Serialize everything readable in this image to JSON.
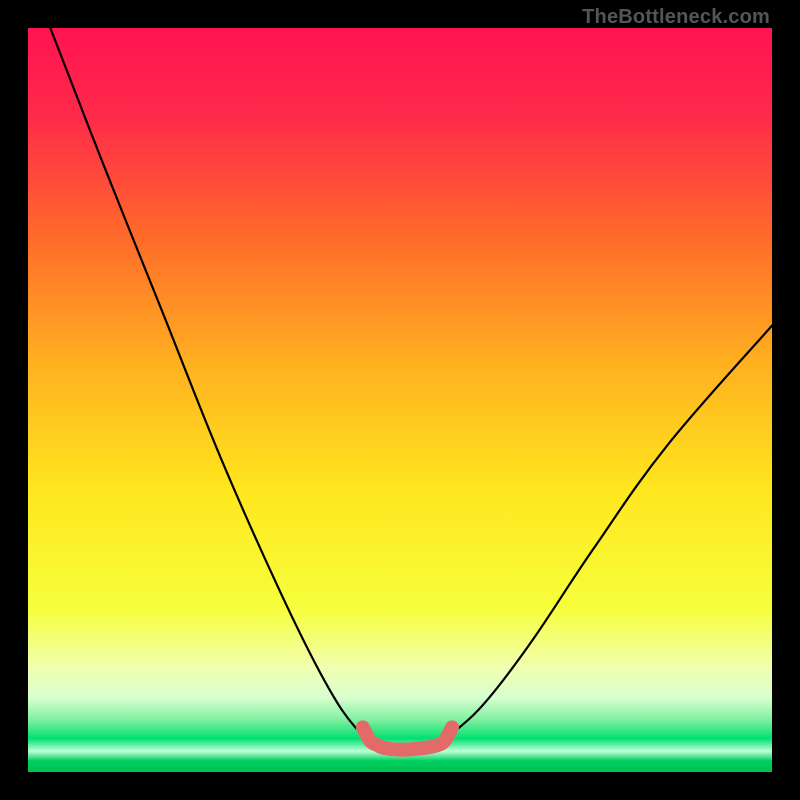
{
  "watermark": "TheBottleneck.com",
  "colors": {
    "frame": "#000000",
    "curve": "#000000",
    "accent": "#e46a6a",
    "gradient_stops": [
      {
        "offset": 0.0,
        "color": "#ff1450"
      },
      {
        "offset": 0.12,
        "color": "#ff2a4a"
      },
      {
        "offset": 0.28,
        "color": "#ff6a2a"
      },
      {
        "offset": 0.45,
        "color": "#ffb020"
      },
      {
        "offset": 0.62,
        "color": "#ffe61e"
      },
      {
        "offset": 0.78,
        "color": "#f6ff3c"
      },
      {
        "offset": 0.86,
        "color": "#f0ffb0"
      },
      {
        "offset": 0.9,
        "color": "#d8ffd0"
      },
      {
        "offset": 0.93,
        "color": "#80f0a0"
      },
      {
        "offset": 0.955,
        "color": "#00e070"
      },
      {
        "offset": 0.972,
        "color": "#c0ffd8"
      },
      {
        "offset": 0.985,
        "color": "#00d060"
      },
      {
        "offset": 1.0,
        "color": "#00c050"
      }
    ]
  },
  "chart_data": {
    "type": "line",
    "title": "",
    "xlabel": "",
    "ylabel": "",
    "xlim": [
      0,
      100
    ],
    "ylim": [
      0,
      100
    ],
    "series": [
      {
        "name": "left-curve",
        "x": [
          3,
          10,
          18,
          26,
          34,
          40,
          44,
          47
        ],
        "y": [
          100,
          82,
          62,
          42,
          24,
          12,
          6,
          4
        ]
      },
      {
        "name": "right-curve",
        "x": [
          55,
          58,
          62,
          68,
          76,
          86,
          100
        ],
        "y": [
          4,
          6,
          10,
          18,
          30,
          44,
          60
        ]
      },
      {
        "name": "valley-accent",
        "x": [
          45,
          46,
          47,
          48,
          50,
          53,
          55,
          56,
          57
        ],
        "y": [
          6,
          4.2,
          3.6,
          3.2,
          3.0,
          3.2,
          3.6,
          4.2,
          6
        ]
      }
    ],
    "annotations": []
  }
}
